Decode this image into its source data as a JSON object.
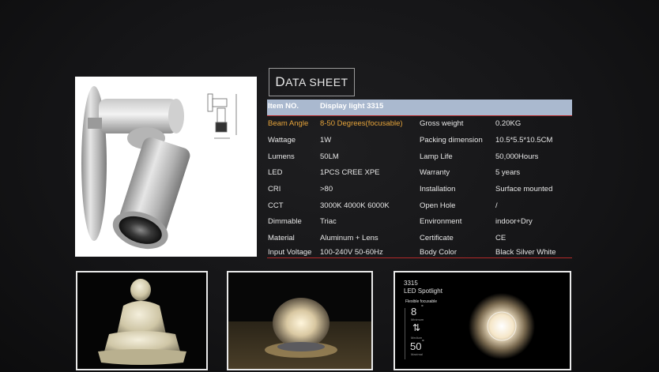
{
  "title": {
    "first": "D",
    "rest": "ATA  SHEET"
  },
  "header": {
    "label": "Item NO.",
    "value": "Display light 3315"
  },
  "rows": [
    {
      "l1": "Beam Angle",
      "v1": "8-50 Degrees(focusable)",
      "l2": "Gross weight",
      "v2": "0.20KG"
    },
    {
      "l1": "Wattage",
      "v1": "1W",
      "l2": "Packing dimension",
      "v2": "10.5*5.5*10.5CM"
    },
    {
      "l1": "Lumens",
      "v1": "50LM",
      "l2": "Lamp Life",
      "v2": "50,000Hours"
    },
    {
      "l1": "LED",
      "v1": "1PCS CREE XPE",
      "l2": "Warranty",
      "v2": "5 years"
    },
    {
      "l1": "CRI",
      "v1": ">80",
      "l2": "Installation",
      "v2": "Surface mounted"
    },
    {
      "l1": "CCT",
      "v1": "3000K 4000K 6000K",
      "l2": "Open Hole",
      "v2": "/"
    },
    {
      "l1": "Dimmable",
      "v1": "Triac",
      "l2": "Environment",
      "v2": "indoor+Dry"
    },
    {
      "l1": "Material",
      "v1": "Aluminum + Lens",
      "l2": "Certificate",
      "v2": "CE"
    },
    {
      "l1": "Input Voltage",
      "v1": "100-240V 50-60Hz",
      "l2": "Body Color",
      "v2": "Black Silver White"
    }
  ],
  "accent_color": "#e6a43a",
  "header_bg": "#aab9cf",
  "line_color": "#b42a2a",
  "spotlight_card": {
    "model": "3315",
    "name": "LED Spotlight",
    "subtitle": "Flexible focusable",
    "min_angle": "8",
    "min_label": "Minimum",
    "mid_label": "Medium",
    "max_angle": "50",
    "max_label": "Maximal",
    "degree": "°"
  }
}
